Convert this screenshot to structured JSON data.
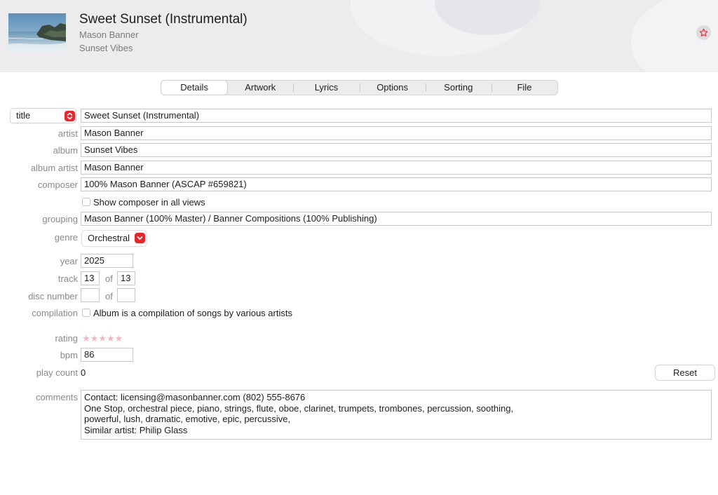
{
  "header": {
    "title": "Sweet Sunset (Instrumental)",
    "artist": "Mason Banner",
    "album": "Sunset Vibes",
    "artwork_icon": "album-artwork",
    "favorite_icon": "star-icon"
  },
  "tabs": [
    {
      "label": "Details",
      "active": true
    },
    {
      "label": "Artwork"
    },
    {
      "label": "Lyrics"
    },
    {
      "label": "Options"
    },
    {
      "label": "Sorting"
    },
    {
      "label": "File"
    }
  ],
  "fields": {
    "title": {
      "selector_label": "title",
      "value": "Sweet Sunset (Instrumental)"
    },
    "artist": {
      "label": "artist",
      "value": "Mason Banner"
    },
    "album": {
      "label": "album",
      "value": "Sunset Vibes"
    },
    "album_artist": {
      "label": "album artist",
      "value": "Mason Banner"
    },
    "composer": {
      "label": "composer",
      "value": "100% Mason Banner (ASCAP #659821)"
    },
    "show_composer": {
      "label": "Show composer in all views",
      "checked": false
    },
    "grouping": {
      "label": "grouping",
      "value": "Mason Banner (100% Master) / Banner Compositions (100% Publishing)"
    },
    "genre": {
      "label": "genre",
      "value": "Orchestral"
    },
    "year": {
      "label": "year",
      "value": "2025"
    },
    "track": {
      "label": "track",
      "number": "13",
      "of_label": "of",
      "total": "13"
    },
    "disc": {
      "label": "disc number",
      "number": "",
      "of_label": "of",
      "total": ""
    },
    "compilation": {
      "label": "compilation",
      "checkbox_label": "Album is a compilation of songs by various artists",
      "checked": false
    },
    "rating": {
      "label": "rating",
      "stars": "★★★★★",
      "value": 0,
      "max": 5
    },
    "bpm": {
      "label": "bpm",
      "value": "86"
    },
    "play_count": {
      "label": "play count",
      "value": "0",
      "reset_label": "Reset"
    },
    "comments": {
      "label": "comments",
      "lines": [
        "Contact: licensing@masonbanner.com (802) 555-8676",
        "One Stop, orchestral piece, piano, strings, flute, oboe, clarinet, trumpets, trombones, percussion, soothing,",
        "powerful, lush, dramatic, emotive, epic, percussive,",
        "Similar artist: Philip Glass"
      ]
    }
  },
  "colors": {
    "accent_red": "#e4262d",
    "header_bg": "#ececee",
    "label_gray": "#8a8a8e",
    "star_empty": "#f2b9bc"
  }
}
